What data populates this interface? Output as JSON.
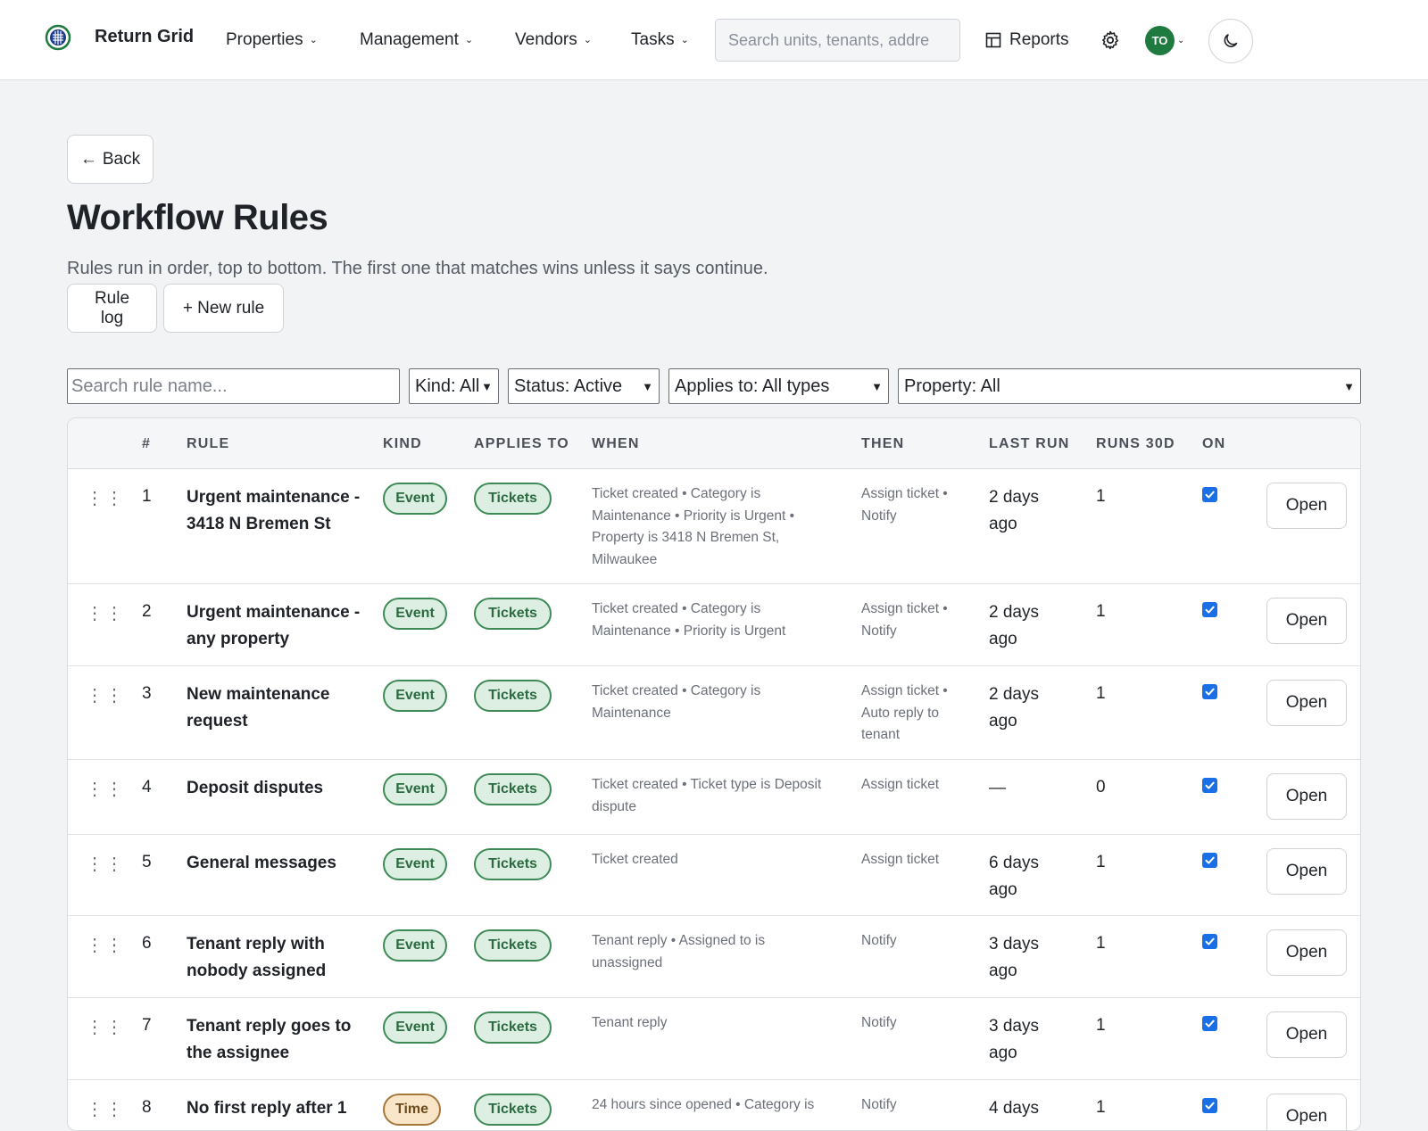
{
  "app": {
    "name": "Return Grid"
  },
  "nav": {
    "items": [
      {
        "label": "Properties"
      },
      {
        "label": "Management"
      },
      {
        "label": "Vendors"
      },
      {
        "label": "Tasks"
      }
    ],
    "search_placeholder": "Search units, tenants, addre",
    "reports_label": "Reports",
    "avatar_initials": "TO"
  },
  "page": {
    "back_label": "Back",
    "title": "Workflow Rules",
    "subtitle": "Rules run in order, top to bottom. The first one that matches wins unless it says continue.",
    "rule_log_label": "Rule log",
    "new_rule_label": "+ New rule"
  },
  "filters": {
    "search_placeholder": "Search rule name...",
    "kind": "Kind: All",
    "status": "Status: Active",
    "applies_to": "Applies to: All types",
    "property": "Property: All"
  },
  "table": {
    "headers": {
      "num": "#",
      "rule": "RULE",
      "kind": "KIND",
      "applies_to": "APPLIES TO",
      "when": "WHEN",
      "then": "THEN",
      "last_run": "LAST RUN",
      "runs_30d": "RUNS 30D",
      "on": "ON"
    },
    "open_label": "Open",
    "rows": [
      {
        "num": "1",
        "name": "Urgent maintenance - 3418 N Bremen St",
        "kind": "Event",
        "applies_to": "Tickets",
        "when": "Ticket created • Category is Maintenance • Priority is Urgent • Property is 3418 N Bremen St, Milwaukee",
        "then": "Assign ticket • Notify",
        "last_run": "2 days ago",
        "runs_30d": "1",
        "on": true
      },
      {
        "num": "2",
        "name": "Urgent maintenance - any property",
        "kind": "Event",
        "applies_to": "Tickets",
        "when": "Ticket created • Category is Maintenance • Priority is Urgent",
        "then": "Assign ticket • Notify",
        "last_run": "2 days ago",
        "runs_30d": "1",
        "on": true
      },
      {
        "num": "3",
        "name": "New maintenance request",
        "kind": "Event",
        "applies_to": "Tickets",
        "when": "Ticket created • Category is Maintenance",
        "then": "Assign ticket • Auto reply to tenant",
        "last_run": "2 days ago",
        "runs_30d": "1",
        "on": true
      },
      {
        "num": "4",
        "name": "Deposit disputes",
        "kind": "Event",
        "applies_to": "Tickets",
        "when": "Ticket created • Ticket type is Deposit dispute",
        "then": "Assign ticket",
        "last_run": "—",
        "runs_30d": "0",
        "on": true
      },
      {
        "num": "5",
        "name": "General messages",
        "kind": "Event",
        "applies_to": "Tickets",
        "when": "Ticket created",
        "then": "Assign ticket",
        "last_run": "6 days ago",
        "runs_30d": "1",
        "on": true
      },
      {
        "num": "6",
        "name": "Tenant reply with nobody assigned",
        "kind": "Event",
        "applies_to": "Tickets",
        "when": "Tenant reply • Assigned to is unassigned",
        "then": "Notify",
        "last_run": "3 days ago",
        "runs_30d": "1",
        "on": true
      },
      {
        "num": "7",
        "name": "Tenant reply goes to the assignee",
        "kind": "Event",
        "applies_to": "Tickets",
        "when": "Tenant reply",
        "then": "Notify",
        "last_run": "3 days ago",
        "runs_30d": "1",
        "on": true
      },
      {
        "num": "8",
        "name": "No first reply after 1",
        "kind": "Time",
        "applies_to": "Tickets",
        "when": "24 hours since opened • Category is",
        "then": "Notify",
        "last_run": "4 days",
        "runs_30d": "1",
        "on": true
      }
    ]
  },
  "colors": {
    "accent_green": "#1f7a3f",
    "event_pill": "#dcefe2",
    "time_pill": "#f9e5c8",
    "checkbox": "#1a6ee6"
  },
  "icons": [
    "logo-icon",
    "chevron-down-icon",
    "table-icon",
    "gear-icon",
    "moon-icon",
    "arrow-left-icon",
    "drag-handle-icon",
    "checkbox-checked-icon"
  ]
}
